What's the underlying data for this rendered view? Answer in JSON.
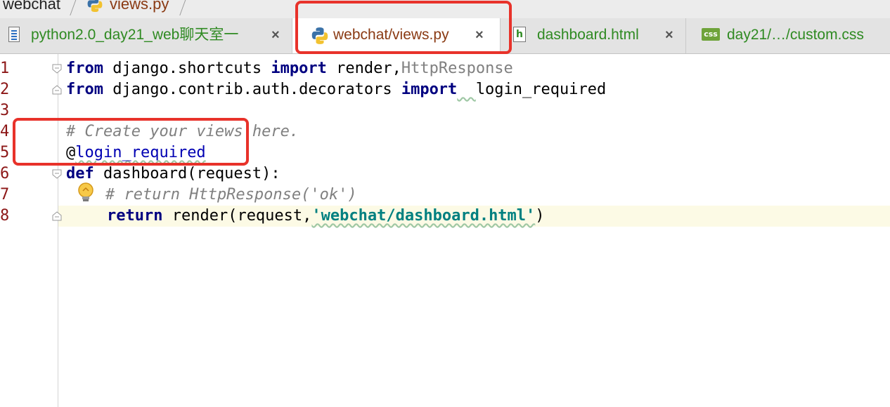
{
  "breadcrumb": {
    "project": "webchat",
    "file": "views.py"
  },
  "tabs": [
    {
      "label": "python2.0_day21_web聊天室一",
      "close": "×",
      "icon": "text-file-icon",
      "active": false
    },
    {
      "label": "webchat/views.py",
      "close": "×",
      "icon": "python-file-icon",
      "active": true
    },
    {
      "label": "dashboard.html",
      "close": "×",
      "icon": "html-file-icon",
      "active": false
    },
    {
      "label": "day21/…/custom.css",
      "icon": "css-file-icon",
      "active": false
    }
  ],
  "css_icon_text": "css",
  "html_icon_text": "h",
  "editor": {
    "line_numbers": [
      "1",
      "2",
      "3",
      "4",
      "5",
      "6",
      "7",
      "8"
    ],
    "lines": {
      "l1": {
        "kw1": "from",
        "mod": " django.shortcuts ",
        "kw2": "import",
        "name": " render,",
        "unused": "HttpResponse"
      },
      "l2": {
        "kw1": "from",
        "mod": " django.contrib.auth.decorators ",
        "kw2": "import",
        "sp": "  ",
        "name": "login_required"
      },
      "l4": {
        "comment": "# Create your views here."
      },
      "l5": {
        "at": "@",
        "name": "login_required"
      },
      "l6": {
        "kw": "def",
        "rest": " dashboard(request):"
      },
      "l7": {
        "comment": "# return HttpResponse('ok')"
      },
      "l8": {
        "kw": "return",
        "call": " render(request,",
        "str": "'webchat/dashboard.html'",
        "end": ")"
      }
    }
  },
  "colors": {
    "annotation": "#e8322a",
    "keyword": "#000080",
    "string": "#008080",
    "comment": "#808080",
    "line_number": "#8c1616"
  }
}
